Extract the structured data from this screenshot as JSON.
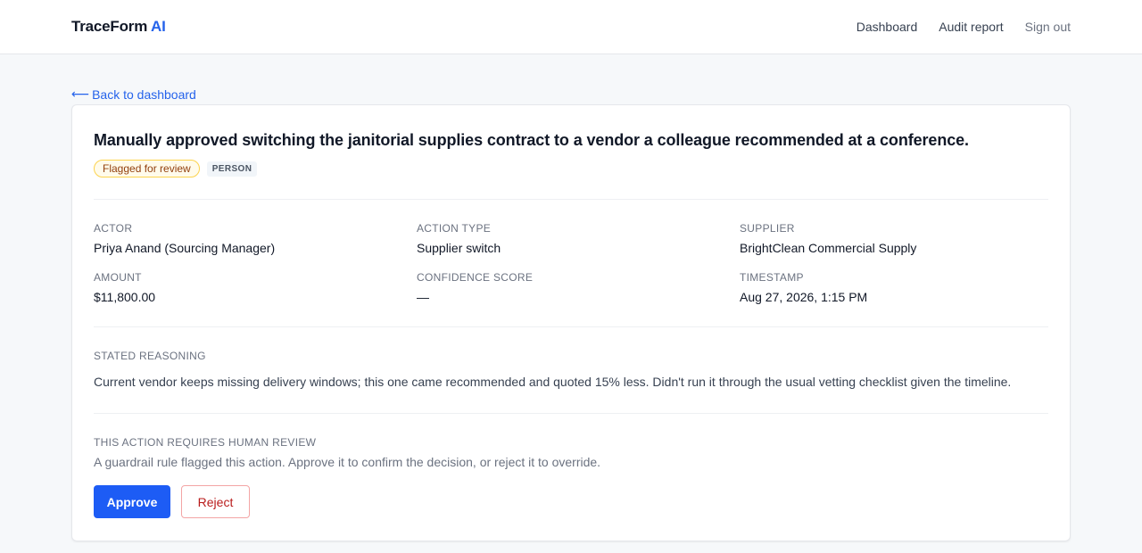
{
  "header": {
    "brand_main": "TraceForm",
    "brand_accent": "AI",
    "nav": [
      {
        "label": "Dashboard"
      },
      {
        "label": "Audit report"
      },
      {
        "label": "Sign out"
      }
    ]
  },
  "back_link": {
    "arrow": "⟵",
    "label": "Back to dashboard"
  },
  "action": {
    "title": "Manually approved switching the janitorial supplies contract to a vendor a colleague recommended at a conference.",
    "status_badge": "Flagged for review",
    "type_badge": "PERSON",
    "fields": [
      {
        "label": "ACTOR",
        "value": "Priya Anand (Sourcing Manager)"
      },
      {
        "label": "ACTION TYPE",
        "value": "Supplier switch"
      },
      {
        "label": "SUPPLIER",
        "value": "BrightClean Commercial Supply"
      },
      {
        "label": "AMOUNT",
        "value": "$11,800.00"
      },
      {
        "label": "CONFIDENCE SCORE",
        "value": "—"
      },
      {
        "label": "TIMESTAMP",
        "value": "Aug 27, 2026, 1:15 PM"
      }
    ],
    "reasoning_label": "STATED REASONING",
    "reasoning_text": "Current vendor keeps missing delivery windows; this one came recommended and quoted 15% less. Didn't run it through the usual vetting checklist given the timeline.",
    "review_label": "THIS ACTION REQUIRES HUMAN REVIEW",
    "review_desc": "A guardrail rule flagged this action. Approve it to confirm the decision, or reject it to override.",
    "approve_label": "Approve",
    "reject_label": "Reject"
  },
  "colors": {
    "accent": "#2563eb",
    "approve": "#1d5cf5",
    "reject": "#b91c1c",
    "flag_border": "#fcd34d"
  }
}
